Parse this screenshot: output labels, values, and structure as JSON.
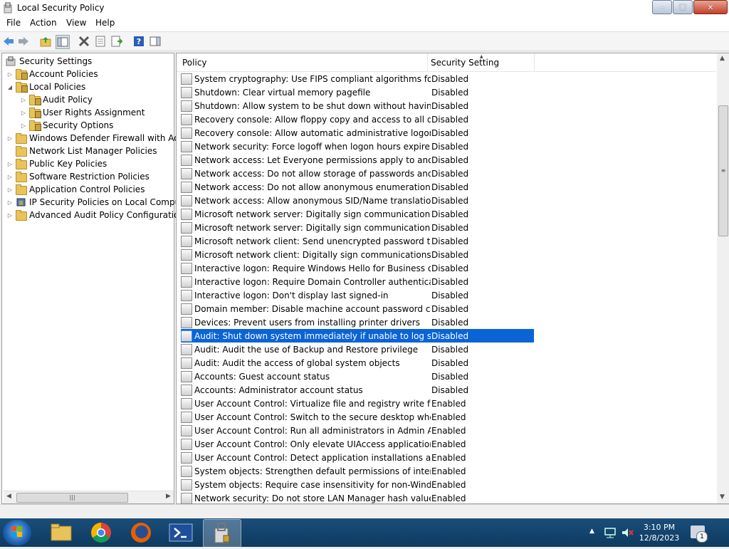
{
  "window": {
    "title": "Local Security Policy"
  },
  "menu": [
    "File",
    "Action",
    "View",
    "Help"
  ],
  "tree": [
    {
      "label": "Security Settings",
      "level": 0,
      "expander": ""
    },
    {
      "label": "Account Policies",
      "level": 1,
      "expander": "right"
    },
    {
      "label": "Local Policies",
      "level": 1,
      "expander": "down"
    },
    {
      "label": "Audit Policy",
      "level": 2,
      "expander": "right"
    },
    {
      "label": "User Rights Assignment",
      "level": 2,
      "expander": "right"
    },
    {
      "label": "Security Options",
      "level": 2,
      "expander": "right"
    },
    {
      "label": "Windows Defender Firewall with Adva",
      "level": 1,
      "expander": "right"
    },
    {
      "label": "Network List Manager Policies",
      "level": 1,
      "expander": ""
    },
    {
      "label": "Public Key Policies",
      "level": 1,
      "expander": "right"
    },
    {
      "label": "Software Restriction Policies",
      "level": 1,
      "expander": "right"
    },
    {
      "label": "Application Control Policies",
      "level": 1,
      "expander": "right"
    },
    {
      "label": "IP Security Policies on Local Compute",
      "level": 1,
      "expander": "right"
    },
    {
      "label": "Advanced Audit Policy Configuration",
      "level": 1,
      "expander": "right"
    }
  ],
  "columns": {
    "policy": "Policy",
    "setting": "Security Setting"
  },
  "rows": [
    {
      "policy": "System cryptography: Use FIPS compliant algorithms for en...",
      "setting": "Disabled"
    },
    {
      "policy": "Shutdown: Clear virtual memory pagefile",
      "setting": "Disabled"
    },
    {
      "policy": "Shutdown: Allow system to be shut down without having to...",
      "setting": "Disabled"
    },
    {
      "policy": "Recovery console: Allow floppy copy and access to all drives...",
      "setting": "Disabled"
    },
    {
      "policy": "Recovery console: Allow automatic administrative logon",
      "setting": "Disabled"
    },
    {
      "policy": "Network security: Force logoff when logon hours expire",
      "setting": "Disabled"
    },
    {
      "policy": "Network access: Let Everyone permissions apply to anonym...",
      "setting": "Disabled"
    },
    {
      "policy": "Network access: Do not allow storage of passwords and cre...",
      "setting": "Disabled"
    },
    {
      "policy": "Network access: Do not allow anonymous enumeration of S...",
      "setting": "Disabled"
    },
    {
      "policy": "Network access: Allow anonymous SID/Name translation",
      "setting": "Disabled"
    },
    {
      "policy": "Microsoft network server: Digitally sign communications (if ...",
      "setting": "Disabled"
    },
    {
      "policy": "Microsoft network server: Digitally sign communications (al...",
      "setting": "Disabled"
    },
    {
      "policy": "Microsoft network client: Send unencrypted password to thi...",
      "setting": "Disabled"
    },
    {
      "policy": "Microsoft network client: Digitally sign communications (al...",
      "setting": "Disabled"
    },
    {
      "policy": "Interactive logon: Require Windows Hello for Business or sm...",
      "setting": "Disabled"
    },
    {
      "policy": "Interactive logon: Require Domain Controller authentication...",
      "setting": "Disabled"
    },
    {
      "policy": "Interactive logon: Don't display last signed-in",
      "setting": "Disabled"
    },
    {
      "policy": "Domain member: Disable machine account password chan...",
      "setting": "Disabled"
    },
    {
      "policy": "Devices: Prevent users from installing printer drivers",
      "setting": "Disabled"
    },
    {
      "policy": "Audit: Shut down system immediately if unable to log secur...",
      "setting": "Disabled"
    },
    {
      "policy": "Audit: Audit the use of Backup and Restore privilege",
      "setting": "Disabled"
    },
    {
      "policy": "Audit: Audit the access of global system objects",
      "setting": "Disabled"
    },
    {
      "policy": "Accounts: Guest account status",
      "setting": "Disabled"
    },
    {
      "policy": "Accounts: Administrator account status",
      "setting": "Disabled"
    },
    {
      "policy": "User Account Control: Virtualize file and registry write failure...",
      "setting": "Enabled"
    },
    {
      "policy": "User Account Control: Switch to the secure desktop when pr...",
      "setting": "Enabled"
    },
    {
      "policy": "User Account Control: Run all administrators in Admin Appr...",
      "setting": "Enabled"
    },
    {
      "policy": "User Account Control: Only elevate UIAccess applications th...",
      "setting": "Enabled"
    },
    {
      "policy": "User Account Control: Detect application installations and p...",
      "setting": "Enabled"
    },
    {
      "policy": "System objects: Strengthen default permissions of internal s...",
      "setting": "Enabled"
    },
    {
      "policy": "System objects: Require case insensitivity for non-Windows ...",
      "setting": "Enabled"
    },
    {
      "policy": "Network security: Do not store LAN Manager hash value on ...",
      "setting": "Enabled"
    }
  ],
  "selected_row": 19,
  "taskbar": {
    "time": "3:10 PM",
    "date": "12/8/2023",
    "notification_count": "1"
  },
  "colors": {
    "selection": "#0a64d6",
    "taskbar": "#0d3a60"
  }
}
